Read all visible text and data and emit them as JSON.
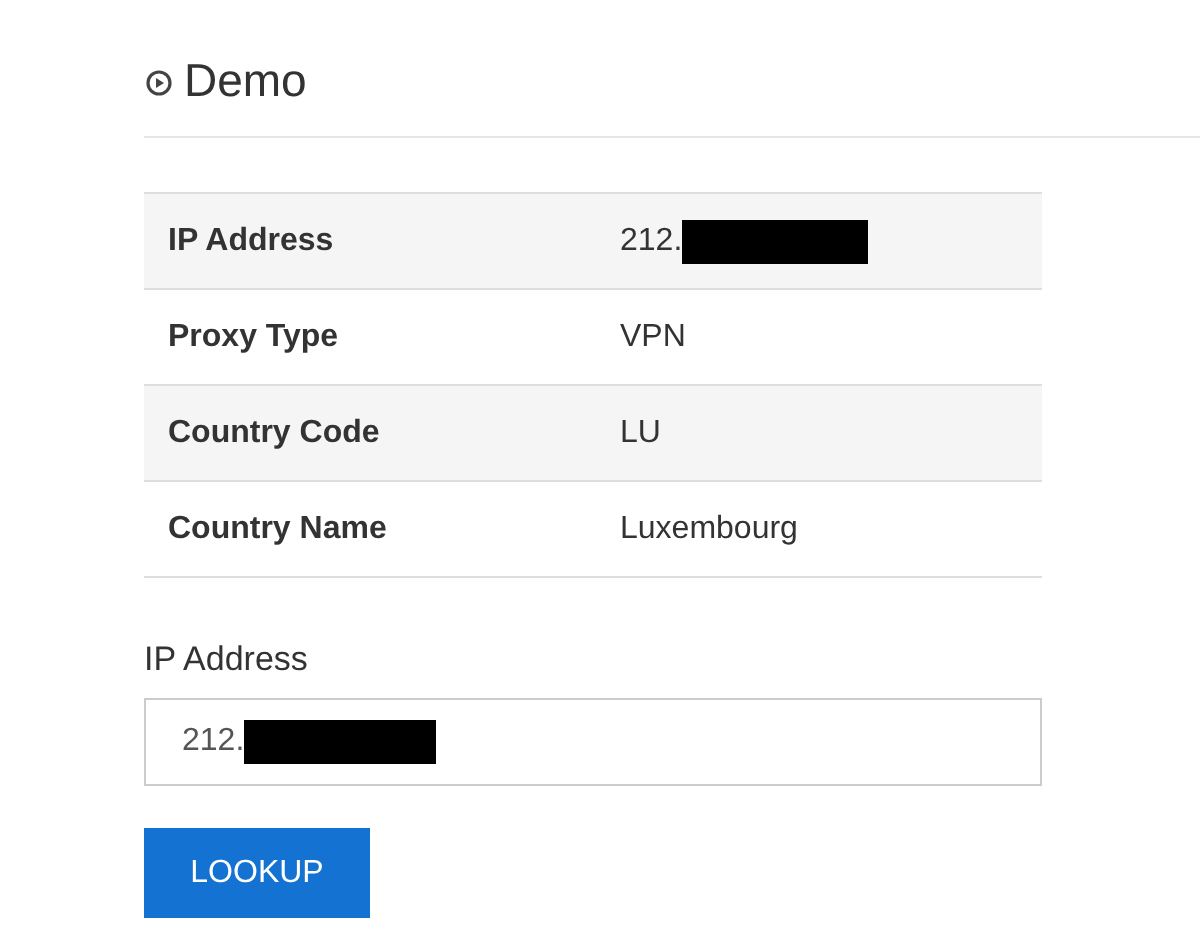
{
  "heading": "Demo",
  "table": {
    "rows": [
      {
        "label": "IP Address",
        "value": "212.",
        "redacted": true
      },
      {
        "label": "Proxy Type",
        "value": "VPN",
        "redacted": false
      },
      {
        "label": "Country Code",
        "value": "LU",
        "redacted": false
      },
      {
        "label": "Country Name",
        "value": "Luxembourg",
        "redacted": false
      }
    ]
  },
  "field": {
    "label": "IP Address",
    "value": "212.",
    "redacted": true
  },
  "button": "LOOKUP"
}
